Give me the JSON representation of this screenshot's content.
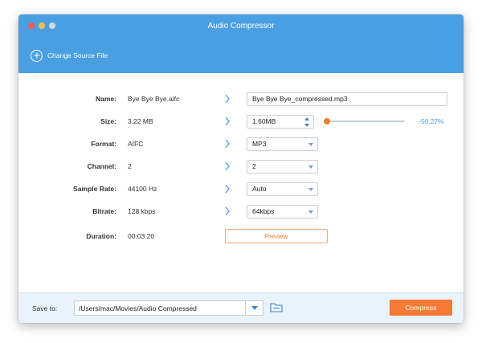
{
  "window": {
    "title": "Audio Compressor"
  },
  "toolbar": {
    "change_source_label": "Change Source File"
  },
  "fields": {
    "name": {
      "label": "Name:",
      "source": "Bye Bye Bye.aifc",
      "output": "Bye Bye Bye_compressed.mp3"
    },
    "size": {
      "label": "Size:",
      "source": "3.22 MB",
      "output": "1.60MB",
      "percent": "-50.27%",
      "slider_fraction": 0.0
    },
    "format": {
      "label": "Format:",
      "source": "AIFC",
      "output": "MP3"
    },
    "channel": {
      "label": "Channel:",
      "source": "2",
      "output": "2"
    },
    "sample_rate": {
      "label": "Sample Rate:",
      "source": "44100 Hz",
      "output": "Auto"
    },
    "bitrate": {
      "label": "Bitrate:",
      "source": "128 kbps",
      "output": "64kbps"
    },
    "duration": {
      "label": "Duration:",
      "source": "00:03:20",
      "preview_label": "Preview"
    }
  },
  "footer": {
    "save_to_label": "Save to:",
    "save_path": "/Users/mac/Movies/Audio Compressed",
    "compress_label": "Compress"
  },
  "colors": {
    "accent_blue": "#4a9fe3",
    "accent_orange": "#f47a36",
    "footer_bg": "#e9f3fc"
  },
  "icons": [
    "plus-circle-icon",
    "chevron-right-icon",
    "dropdown-caret-icon",
    "stepper-icon",
    "folder-icon"
  ]
}
